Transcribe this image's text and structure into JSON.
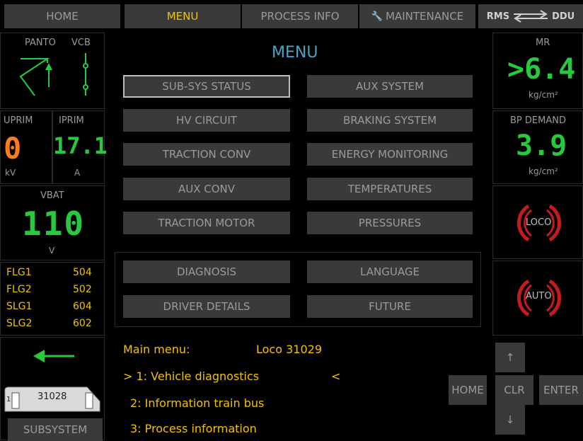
{
  "nav": {
    "home": "HOME",
    "menu": "MENU",
    "process_info": "PROCESS INFO",
    "maintenance": "MAINTENANCE",
    "rms": "RMS",
    "ddu": "DDU"
  },
  "left": {
    "panto": "PANTO",
    "vcb": "VCB",
    "uprim": "UPRIM",
    "iprim": "IPRIM",
    "uprim_value": "0",
    "iprim_value": "17.1",
    "uprim_unit": "kV",
    "iprim_unit": "A",
    "vbat": "VBAT",
    "vbat_value": "110",
    "vbat_unit": "V",
    "flags": [
      {
        "name": "FLG1",
        "value": "504"
      },
      {
        "name": "FLG2",
        "value": "502"
      },
      {
        "name": "SLG1",
        "value": "604"
      },
      {
        "name": "SLG2",
        "value": "602"
      }
    ],
    "loco_number": "31028",
    "subsystem": "SUBSYSTEM"
  },
  "right": {
    "mr": "MR",
    "mr_value": ">6.4",
    "mr_unit": "kg/cm²",
    "bp_demand": "BP DEMAND",
    "bp_value": "3.9",
    "bp_unit": "kg/cm²",
    "loco": "LOCO",
    "auto": "AUTO"
  },
  "menu": {
    "title": "MENU",
    "left_buttons": [
      "SUB-SYS STATUS",
      "HV CIRCUIT",
      "TRACTION CONV",
      "AUX CONV",
      "TRACTION MOTOR"
    ],
    "right_buttons": [
      "AUX SYSTEM",
      "BRAKING SYSTEM",
      "ENERGY MONITORING",
      "TEMPERATURES",
      "PRESSURES"
    ],
    "lower_left": [
      "DIAGNOSIS",
      "DRIVER DETAILS"
    ],
    "lower_right": [
      "LANGUAGE",
      "FUTURE"
    ]
  },
  "bottom": {
    "main_menu": "Main menu:",
    "loco": "Loco 31029",
    "line1": "> 1: Vehicle diagnostics",
    "line1_end": "<",
    "line2": "2: Information train bus",
    "line3": "3: Process information"
  },
  "keys": {
    "up": "↑",
    "home": "HOME",
    "clr": "CLR",
    "enter": "ENTER",
    "down": "↓"
  }
}
